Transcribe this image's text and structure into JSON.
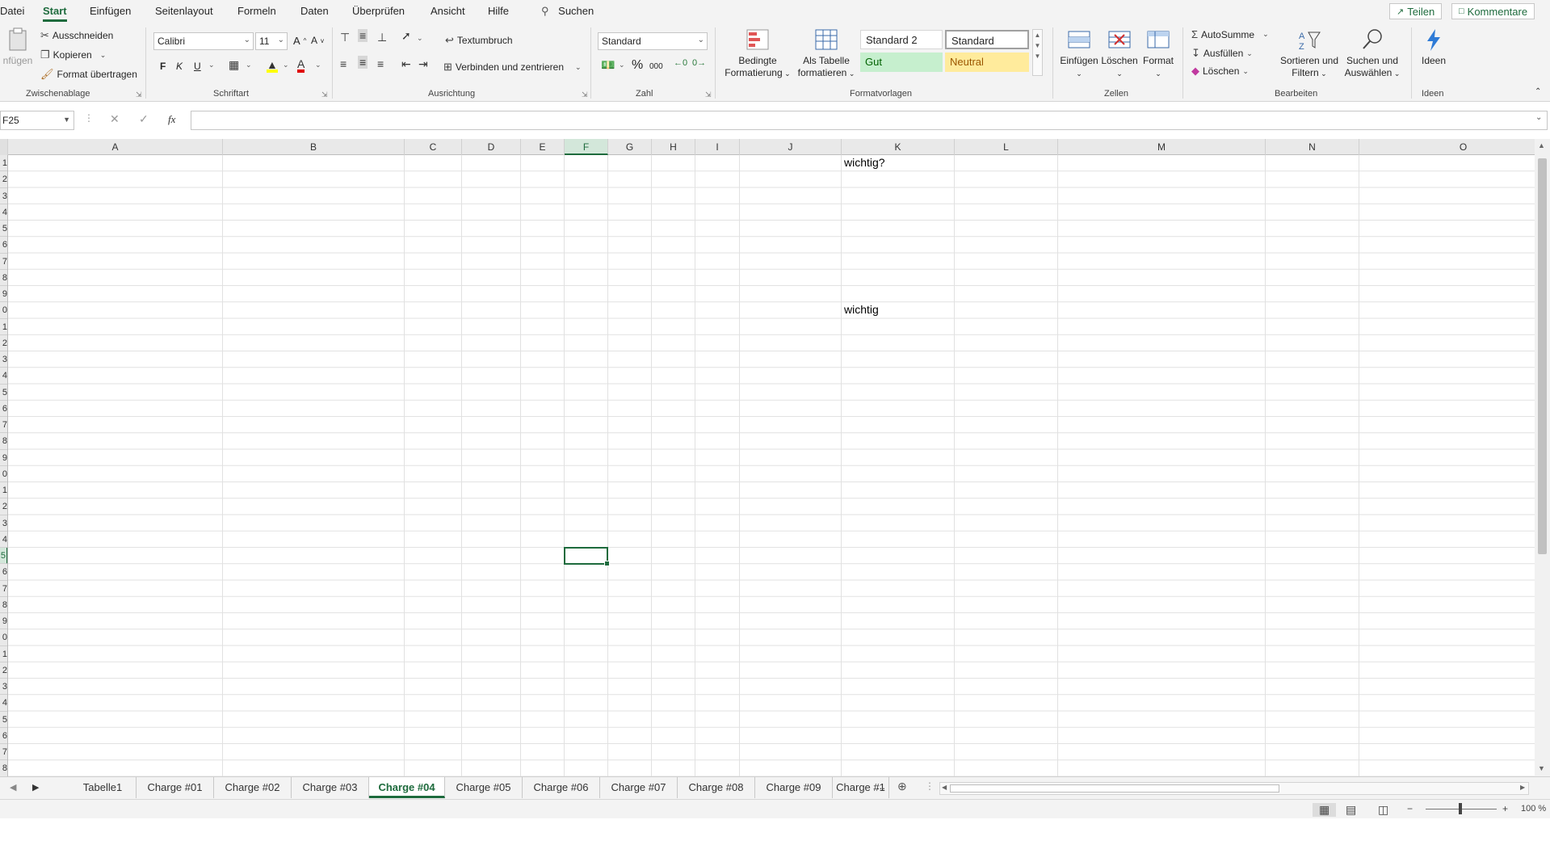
{
  "menu": {
    "items": [
      "Datei",
      "Start",
      "Einfügen",
      "Seitenlayout",
      "Formeln",
      "Daten",
      "Überprüfen",
      "Ansicht",
      "Hilfe"
    ],
    "active": "Start",
    "search": "Suchen",
    "share": "Teilen",
    "comments": "Kommentare"
  },
  "ribbon": {
    "clipboard": {
      "paste": "nfügen",
      "cut": "Ausschneiden",
      "copy": "Kopieren",
      "format_painter": "Format übertragen",
      "label": "Zwischenablage"
    },
    "font": {
      "name": "Calibri",
      "size": "11",
      "grow": "A",
      "shrink": "A",
      "bold": "F",
      "italic": "K",
      "underline": "U",
      "label": "Schriftart"
    },
    "alignment": {
      "wrap": "Textumbruch",
      "merge": "Verbinden und zentrieren",
      "label": "Ausrichtung"
    },
    "number": {
      "format": "Standard",
      "percent": "%",
      "thousands": "000",
      "label": "Zahl"
    },
    "styles": {
      "conditional": [
        "Bedingte",
        "Formatierung"
      ],
      "as_table": [
        "Als Tabelle",
        "formatieren"
      ],
      "standard2": "Standard 2",
      "standard": "Standard",
      "gut": "Gut",
      "neutral": "Neutral",
      "label": "Formatvorlagen"
    },
    "cells": {
      "insert": "Einfügen",
      "delete": "Löschen",
      "format": "Format",
      "label": "Zellen"
    },
    "editing": {
      "autosum": "AutoSumme",
      "fill": "Ausfüllen",
      "clear": "Löschen",
      "sort": [
        "Sortieren und",
        "Filtern"
      ],
      "find": [
        "Suchen und",
        "Auswählen"
      ],
      "label": "Bearbeiten"
    },
    "ideas": {
      "button": "Ideen",
      "label": "Ideen"
    }
  },
  "formula_bar": {
    "name_box": "F25",
    "fx": "fx",
    "value": ""
  },
  "columns": [
    "A",
    "B",
    "C",
    "D",
    "E",
    "F",
    "G",
    "H",
    "I",
    "J",
    "K",
    "L",
    "M",
    "N",
    "O"
  ],
  "selected_column": "F",
  "row_labels": [
    "1",
    "2",
    "3",
    "4",
    "5",
    "6",
    "7",
    "8",
    "9",
    "0",
    "1",
    "2",
    "3",
    "4",
    "5",
    "6",
    "7",
    "8",
    "9",
    "0",
    "1",
    "2",
    "3",
    "4",
    "5",
    "6",
    "7",
    "8",
    "9",
    "0",
    "1",
    "2",
    "3",
    "4",
    "5",
    "6",
    "7",
    "8"
  ],
  "selected_row_index": 24,
  "cells": {
    "K1": "wichtig?",
    "K10": "wichtig"
  },
  "sheets": [
    "Tabelle1",
    "Charge #01",
    "Charge #02",
    "Charge #03",
    "Charge #04",
    "Charge #05",
    "Charge #06",
    "Charge #07",
    "Charge #08",
    "Charge #09",
    "Charge #1"
  ],
  "active_sheet": "Charge #04",
  "sheet_more": "...",
  "status": {
    "zoom": "100 %",
    "minus": "−",
    "plus": "+"
  }
}
